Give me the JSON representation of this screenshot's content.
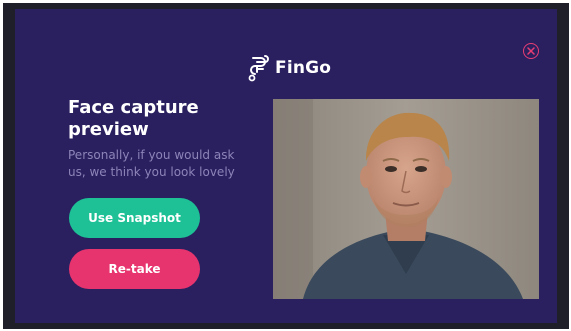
{
  "brand": {
    "name": "FinGo",
    "logo_icon": "fingo-logo-icon"
  },
  "dialog": {
    "title": "Face capture preview",
    "subtitle": "Personally, if you would ask us, we think you look lovely",
    "close_icon": "close-circle-icon"
  },
  "actions": {
    "use_snapshot_label": "Use Snapshot",
    "retake_label": "Re-take"
  },
  "colors": {
    "background": "#2a2060",
    "primary_button": "#1ec196",
    "secondary_button": "#e8346e",
    "close_icon": "#e83d73",
    "subtitle_text": "#8d84b8"
  }
}
